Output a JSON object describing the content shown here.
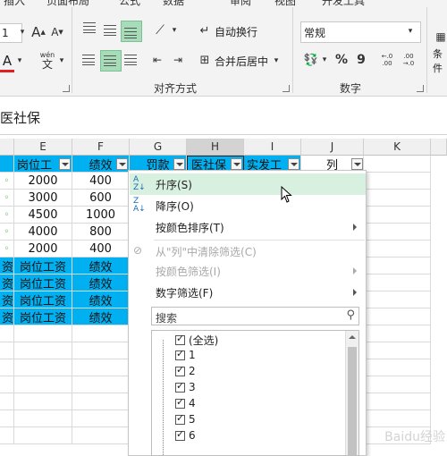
{
  "ribbon": {
    "tabs": [
      "插入",
      "页面布局",
      "公式",
      "数据",
      "审阅",
      "视图",
      "开发工具"
    ],
    "font_size_value": "1",
    "grow_font": "A",
    "shrink_font": "A",
    "font_color_letter": "A",
    "wen_label": "wén",
    "wen_char": "文",
    "wrap_text": "自动换行",
    "merge_center": "合并后居中",
    "number_format": "常规",
    "percent": "%",
    "comma": "9",
    "dec_inc": "←.0 .00",
    "dec_dec": ".00 →.0",
    "cond_format_partial": "条件",
    "group_alignment": "对齐方式",
    "group_number": "数字",
    "accent_color": "#a6dcb8"
  },
  "formula_bar": {
    "text": "医社保"
  },
  "grid": {
    "columns": [
      "E",
      "F",
      "G",
      "H",
      "I",
      "J",
      "K"
    ],
    "header_row": {
      "E": "岗位工",
      "F": "绩效",
      "G": "罚款",
      "H": "医社保",
      "I": "实发工",
      "J": "列"
    },
    "rows": [
      {
        "E": "2000",
        "F": "400"
      },
      {
        "E": "3000",
        "F": "600"
      },
      {
        "E": "4500",
        "F": "1000"
      },
      {
        "E": "4000",
        "F": "800"
      },
      {
        "E": "2000",
        "F": "400"
      },
      {
        "D": "资",
        "E": "岗位工资",
        "F": "绩效"
      },
      {
        "D": "资",
        "E": "岗位工资",
        "F": "绩效"
      },
      {
        "D": "资",
        "E": "岗位工资",
        "F": "绩效"
      },
      {
        "D": "资",
        "E": "岗位工资",
        "F": "绩效"
      }
    ],
    "fill_color": "#00b0f0"
  },
  "filter_menu": {
    "sort_asc": "升序(S)",
    "sort_desc": "降序(O)",
    "sort_by_color": "按颜色排序(T)",
    "clear_filter": "从\"列\"中清除筛选(C)",
    "filter_by_color": "按颜色筛选(I)",
    "number_filters": "数字筛选(F)",
    "search_placeholder": "搜索",
    "list": [
      "(全选)",
      "1",
      "2",
      "3",
      "4",
      "5",
      "6"
    ],
    "hover_color": "#d8f0df"
  },
  "watermark": "Baidu经验"
}
